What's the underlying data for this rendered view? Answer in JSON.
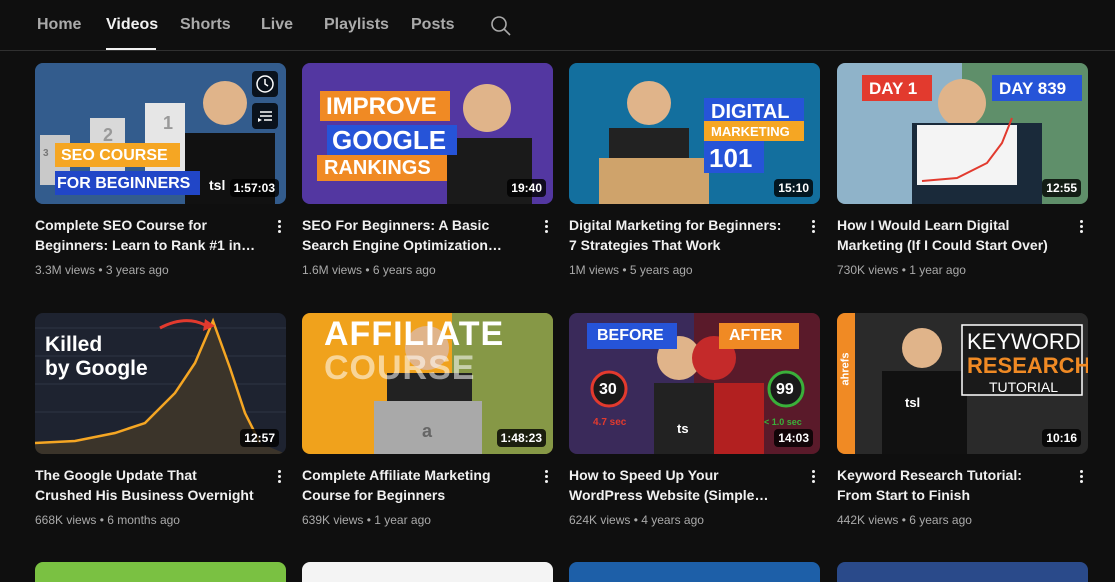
{
  "tabs": [
    {
      "label": "Home",
      "active": false
    },
    {
      "label": "Videos",
      "active": true
    },
    {
      "label": "Shorts",
      "active": false
    },
    {
      "label": "Live",
      "active": false
    },
    {
      "label": "Playlists",
      "active": false
    },
    {
      "label": "Posts",
      "active": false
    }
  ],
  "search_icon": "search-icon",
  "videos": [
    {
      "title": "Complete SEO Course for Beginners: Learn to Rank #1 in…",
      "views": "3.3M views",
      "age": "3 years ago",
      "duration": "1:57:03",
      "thumb_text": [
        "SEO COURSE",
        "FOR BEGINNERS",
        "tsl",
        "3",
        "2",
        "1"
      ],
      "hover_icons": [
        "clock-icon",
        "queue-icon"
      ]
    },
    {
      "title": "SEO For Beginners: A Basic Search Engine Optimization Tutorial for…",
      "views": "1.6M views",
      "age": "6 years ago",
      "duration": "19:40",
      "thumb_text": [
        "IMPROVE",
        "GOOGLE",
        "RANKINGS"
      ]
    },
    {
      "title": "Digital Marketing for Beginners: 7 Strategies That Work",
      "views": "1M views",
      "age": "5 years ago",
      "duration": "15:10",
      "thumb_text": [
        "DIGITAL",
        "MARKETING",
        "101"
      ]
    },
    {
      "title": "How I Would Learn Digital Marketing (If I Could Start Over)",
      "views": "730K views",
      "age": "1 year ago",
      "duration": "12:55",
      "thumb_text": [
        "DAY 1",
        "DAY 839"
      ]
    },
    {
      "title": "The Google Update That Crushed His Business Overnight",
      "views": "668K views",
      "age": "6 months ago",
      "duration": "12:57",
      "thumb_text": [
        "Killed",
        "by Google"
      ]
    },
    {
      "title": "Complete Affiliate Marketing Course for Beginners",
      "views": "639K views",
      "age": "1 year ago",
      "duration": "1:48:23",
      "thumb_text": [
        "AFFILIATE",
        "COURSE",
        "a"
      ]
    },
    {
      "title": "How to Speed Up Your WordPress Website (Simple Guide)",
      "views": "624K views",
      "age": "4 years ago",
      "duration": "14:03",
      "thumb_text": [
        "BEFORE",
        "AFTER",
        "30",
        "4.7 sec",
        "99",
        "< 1.0 sec",
        "ts"
      ]
    },
    {
      "title": "Keyword Research Tutorial: From Start to Finish",
      "views": "442K views",
      "age": "6 years ago",
      "duration": "10:16",
      "thumb_text": [
        "KEYWORD",
        "RESEARCH",
        "TUTORIAL",
        "ahrefs",
        "tsl"
      ]
    }
  ]
}
